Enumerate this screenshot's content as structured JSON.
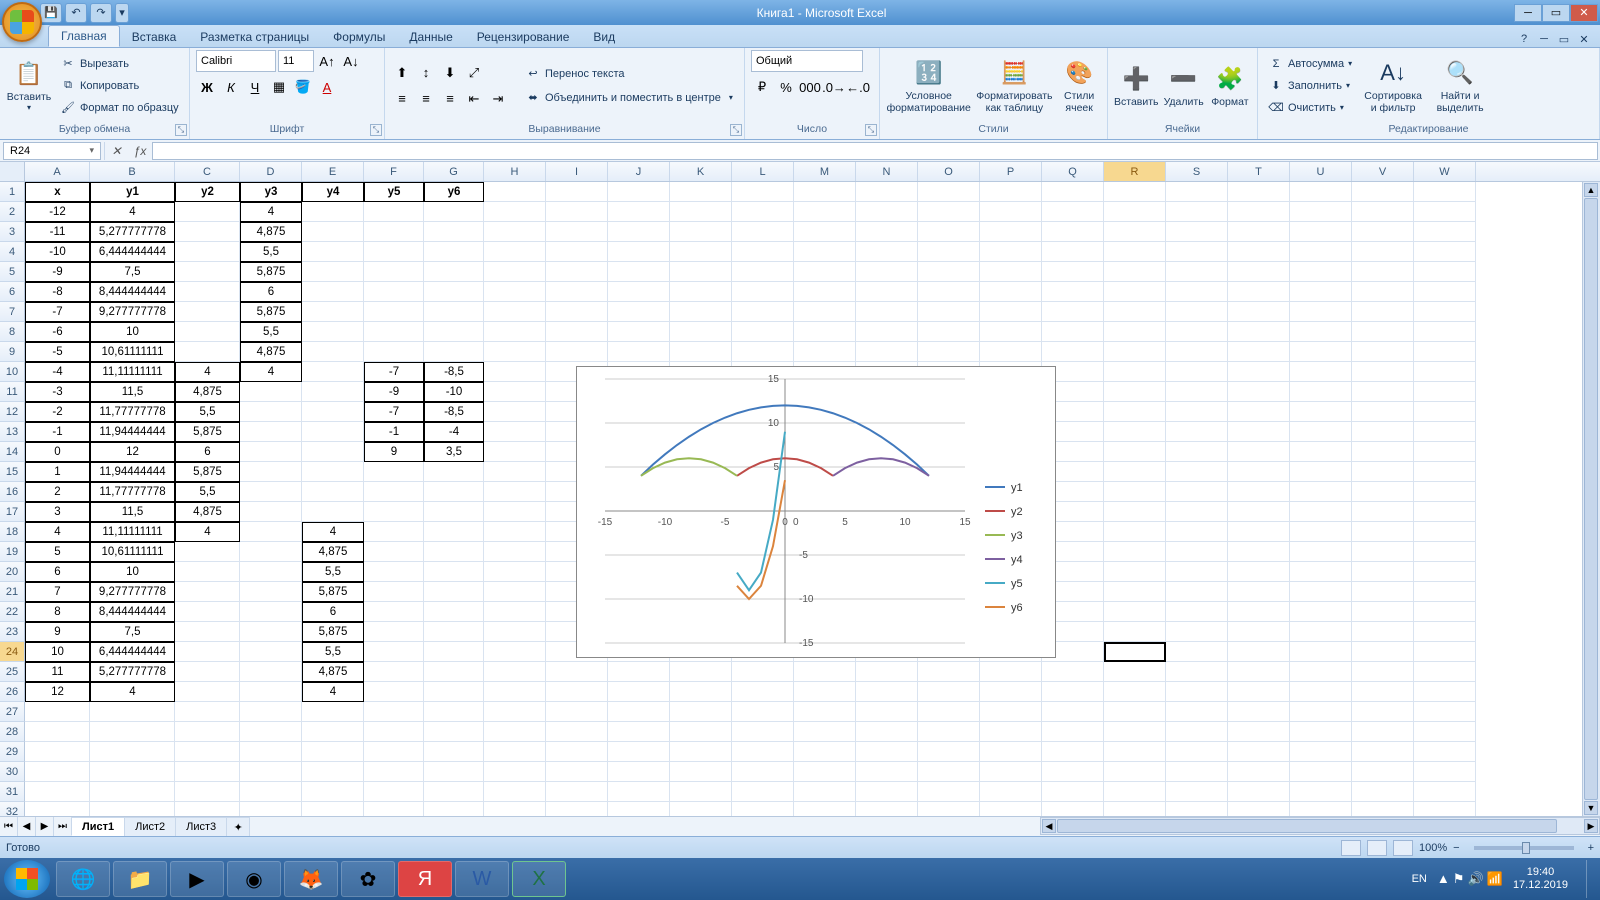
{
  "title": "Книга1 - Microsoft Excel",
  "tabs": [
    "Главная",
    "Вставка",
    "Разметка страницы",
    "Формулы",
    "Данные",
    "Рецензирование",
    "Вид"
  ],
  "active_tab": 0,
  "ribbon": {
    "clipboard": {
      "label": "Буфер обмена",
      "paste": "Вставить",
      "cut": "Вырезать",
      "copy": "Копировать",
      "fmt": "Формат по образцу"
    },
    "font": {
      "label": "Шрифт",
      "name": "Calibri",
      "size": "11"
    },
    "align": {
      "label": "Выравнивание",
      "wrap": "Перенос текста",
      "merge": "Объединить и поместить в центре"
    },
    "number": {
      "label": "Число",
      "fmt": "Общий"
    },
    "styles": {
      "label": "Стили",
      "cond": "Условное\nформатирование",
      "tbl": "Форматировать\nкак таблицу",
      "cell": "Стили\nячеек"
    },
    "cells": {
      "label": "Ячейки",
      "ins": "Вставить",
      "del": "Удалить",
      "fmt": "Формат"
    },
    "editing": {
      "label": "Редактирование",
      "sum": "Автосумма",
      "fill": "Заполнить",
      "clear": "Очистить",
      "sort": "Сортировка\nи фильтр",
      "find": "Найти и\nвыделить"
    }
  },
  "name_box": "R24",
  "columns": [
    "A",
    "B",
    "C",
    "D",
    "E",
    "F",
    "G",
    "H",
    "I",
    "J",
    "K",
    "L",
    "M",
    "N",
    "O",
    "P",
    "Q",
    "R",
    "S",
    "T",
    "U",
    "V",
    "W"
  ],
  "col_widths": {
    "A": 65,
    "B": 85,
    "C": 65,
    "D": 62,
    "E": 62,
    "F": 60,
    "G": 60,
    "default": 62
  },
  "active_col_index": 17,
  "active_row": 24,
  "headers_row": {
    "A": "x",
    "B": "y1",
    "C": "y2",
    "D": "y3",
    "E": "y4",
    "F": "y5",
    "G": "y6"
  },
  "table": [
    {
      "r": 2,
      "A": "-12",
      "B": "4",
      "D": "4"
    },
    {
      "r": 3,
      "A": "-11",
      "B": "5,277777778",
      "D": "4,875"
    },
    {
      "r": 4,
      "A": "-10",
      "B": "6,444444444",
      "D": "5,5"
    },
    {
      "r": 5,
      "A": "-9",
      "B": "7,5",
      "D": "5,875"
    },
    {
      "r": 6,
      "A": "-8",
      "B": "8,444444444",
      "D": "6"
    },
    {
      "r": 7,
      "A": "-7",
      "B": "9,277777778",
      "D": "5,875"
    },
    {
      "r": 8,
      "A": "-6",
      "B": "10",
      "D": "5,5"
    },
    {
      "r": 9,
      "A": "-5",
      "B": "10,61111111",
      "D": "4,875"
    },
    {
      "r": 10,
      "A": "-4",
      "B": "11,11111111",
      "C": "4",
      "D": "4",
      "F": "-7",
      "G": "-8,5"
    },
    {
      "r": 11,
      "A": "-3",
      "B": "11,5",
      "C": "4,875",
      "F": "-9",
      "G": "-10"
    },
    {
      "r": 12,
      "A": "-2",
      "B": "11,77777778",
      "C": "5,5",
      "F": "-7",
      "G": "-8,5"
    },
    {
      "r": 13,
      "A": "-1",
      "B": "11,94444444",
      "C": "5,875",
      "F": "-1",
      "G": "-4"
    },
    {
      "r": 14,
      "A": "0",
      "B": "12",
      "C": "6",
      "F": "9",
      "G": "3,5"
    },
    {
      "r": 15,
      "A": "1",
      "B": "11,94444444",
      "C": "5,875"
    },
    {
      "r": 16,
      "A": "2",
      "B": "11,77777778",
      "C": "5,5"
    },
    {
      "r": 17,
      "A": "3",
      "B": "11,5",
      "C": "4,875"
    },
    {
      "r": 18,
      "A": "4",
      "B": "11,11111111",
      "C": "4",
      "E": "4"
    },
    {
      "r": 19,
      "A": "5",
      "B": "10,61111111",
      "E": "4,875"
    },
    {
      "r": 20,
      "A": "6",
      "B": "10",
      "E": "5,5"
    },
    {
      "r": 21,
      "A": "7",
      "B": "9,277777778",
      "E": "5,875"
    },
    {
      "r": 22,
      "A": "8",
      "B": "8,444444444",
      "E": "6"
    },
    {
      "r": 23,
      "A": "9",
      "B": "7,5",
      "E": "5,875"
    },
    {
      "r": 24,
      "A": "10",
      "B": "6,444444444",
      "E": "5,5"
    },
    {
      "r": 25,
      "A": "11",
      "B": "5,277777778",
      "E": "4,875"
    },
    {
      "r": 26,
      "A": "12",
      "B": "4",
      "E": "4"
    }
  ],
  "bordered_cols_per_row": "see chart_data.cell_borders",
  "total_rows_visible": 32,
  "sheets": [
    "Лист1",
    "Лист2",
    "Лист3"
  ],
  "active_sheet": 0,
  "status": "Готово",
  "zoom": "100%",
  "taskbar": {
    "time": "19:40",
    "date": "17.12.2019",
    "lang": "EN"
  },
  "chart_data": {
    "type": "line",
    "xlim": [
      -15,
      15
    ],
    "ylim": [
      -15,
      15
    ],
    "xticks": [
      -15,
      -10,
      -5,
      0,
      5,
      10,
      15
    ],
    "yticks": [
      -15,
      -10,
      -5,
      0,
      5,
      10,
      15
    ],
    "legend_pos": "right",
    "series": [
      {
        "name": "y1",
        "color": "#4179bd",
        "x": [
          -12,
          -11,
          -10,
          -9,
          -8,
          -7,
          -6,
          -5,
          -4,
          -3,
          -2,
          -1,
          0,
          1,
          2,
          3,
          4,
          5,
          6,
          7,
          8,
          9,
          10,
          11,
          12
        ],
        "y": [
          4,
          5.28,
          6.44,
          7.5,
          8.44,
          9.28,
          10,
          10.61,
          11.11,
          11.5,
          11.78,
          11.94,
          12,
          11.94,
          11.78,
          11.5,
          11.11,
          10.61,
          10,
          9.28,
          8.44,
          7.5,
          6.44,
          5.28,
          4
        ]
      },
      {
        "name": "y2",
        "color": "#be4b48",
        "x": [
          -4,
          -3,
          -2,
          -1,
          0,
          1,
          2,
          3,
          4
        ],
        "y": [
          4,
          4.875,
          5.5,
          5.875,
          6,
          5.875,
          5.5,
          4.875,
          4
        ]
      },
      {
        "name": "y3",
        "color": "#98b954",
        "x": [
          -12,
          -11,
          -10,
          -9,
          -8,
          -7,
          -6,
          -5,
          -4
        ],
        "y": [
          4,
          4.875,
          5.5,
          5.875,
          6,
          5.875,
          5.5,
          4.875,
          4
        ]
      },
      {
        "name": "y4",
        "color": "#7d60a0",
        "x": [
          4,
          5,
          6,
          7,
          8,
          9,
          10,
          11,
          12
        ],
        "y": [
          4,
          4.875,
          5.5,
          5.875,
          6,
          5.875,
          5.5,
          4.875,
          4
        ]
      },
      {
        "name": "y5",
        "color": "#46aac5",
        "x": [
          -4,
          -3,
          -2,
          -1,
          0
        ],
        "y": [
          -7,
          -9,
          -7,
          -1,
          9
        ]
      },
      {
        "name": "y6",
        "color": "#db843d",
        "x": [
          -4,
          -3,
          -2,
          -1,
          0
        ],
        "y": [
          -8.5,
          -10,
          -8.5,
          -4,
          3.5
        ]
      }
    ]
  }
}
